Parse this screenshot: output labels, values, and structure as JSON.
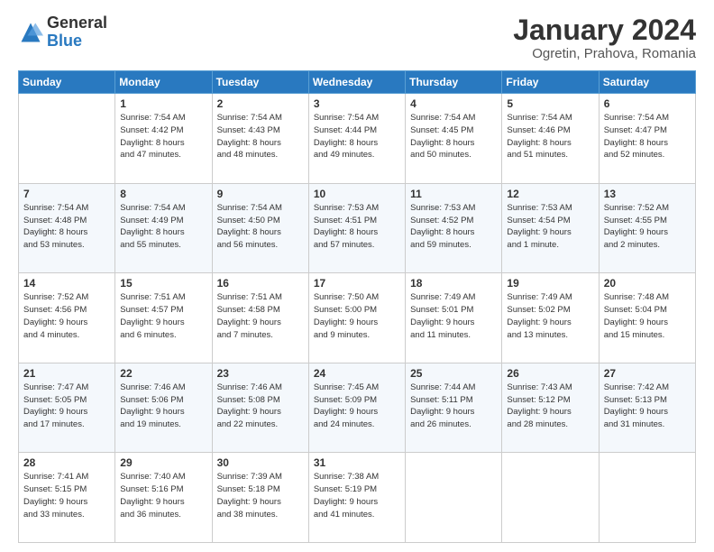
{
  "header": {
    "logo_general": "General",
    "logo_blue": "Blue",
    "title": "January 2024",
    "location": "Ogretin, Prahova, Romania"
  },
  "days_of_week": [
    "Sunday",
    "Monday",
    "Tuesday",
    "Wednesday",
    "Thursday",
    "Friday",
    "Saturday"
  ],
  "weeks": [
    [
      {
        "day": "",
        "info": ""
      },
      {
        "day": "1",
        "info": "Sunrise: 7:54 AM\nSunset: 4:42 PM\nDaylight: 8 hours\nand 47 minutes."
      },
      {
        "day": "2",
        "info": "Sunrise: 7:54 AM\nSunset: 4:43 PM\nDaylight: 8 hours\nand 48 minutes."
      },
      {
        "day": "3",
        "info": "Sunrise: 7:54 AM\nSunset: 4:44 PM\nDaylight: 8 hours\nand 49 minutes."
      },
      {
        "day": "4",
        "info": "Sunrise: 7:54 AM\nSunset: 4:45 PM\nDaylight: 8 hours\nand 50 minutes."
      },
      {
        "day": "5",
        "info": "Sunrise: 7:54 AM\nSunset: 4:46 PM\nDaylight: 8 hours\nand 51 minutes."
      },
      {
        "day": "6",
        "info": "Sunrise: 7:54 AM\nSunset: 4:47 PM\nDaylight: 8 hours\nand 52 minutes."
      }
    ],
    [
      {
        "day": "7",
        "info": "Sunrise: 7:54 AM\nSunset: 4:48 PM\nDaylight: 8 hours\nand 53 minutes."
      },
      {
        "day": "8",
        "info": "Sunrise: 7:54 AM\nSunset: 4:49 PM\nDaylight: 8 hours\nand 55 minutes."
      },
      {
        "day": "9",
        "info": "Sunrise: 7:54 AM\nSunset: 4:50 PM\nDaylight: 8 hours\nand 56 minutes."
      },
      {
        "day": "10",
        "info": "Sunrise: 7:53 AM\nSunset: 4:51 PM\nDaylight: 8 hours\nand 57 minutes."
      },
      {
        "day": "11",
        "info": "Sunrise: 7:53 AM\nSunset: 4:52 PM\nDaylight: 8 hours\nand 59 minutes."
      },
      {
        "day": "12",
        "info": "Sunrise: 7:53 AM\nSunset: 4:54 PM\nDaylight: 9 hours\nand 1 minute."
      },
      {
        "day": "13",
        "info": "Sunrise: 7:52 AM\nSunset: 4:55 PM\nDaylight: 9 hours\nand 2 minutes."
      }
    ],
    [
      {
        "day": "14",
        "info": "Sunrise: 7:52 AM\nSunset: 4:56 PM\nDaylight: 9 hours\nand 4 minutes."
      },
      {
        "day": "15",
        "info": "Sunrise: 7:51 AM\nSunset: 4:57 PM\nDaylight: 9 hours\nand 6 minutes."
      },
      {
        "day": "16",
        "info": "Sunrise: 7:51 AM\nSunset: 4:58 PM\nDaylight: 9 hours\nand 7 minutes."
      },
      {
        "day": "17",
        "info": "Sunrise: 7:50 AM\nSunset: 5:00 PM\nDaylight: 9 hours\nand 9 minutes."
      },
      {
        "day": "18",
        "info": "Sunrise: 7:49 AM\nSunset: 5:01 PM\nDaylight: 9 hours\nand 11 minutes."
      },
      {
        "day": "19",
        "info": "Sunrise: 7:49 AM\nSunset: 5:02 PM\nDaylight: 9 hours\nand 13 minutes."
      },
      {
        "day": "20",
        "info": "Sunrise: 7:48 AM\nSunset: 5:04 PM\nDaylight: 9 hours\nand 15 minutes."
      }
    ],
    [
      {
        "day": "21",
        "info": "Sunrise: 7:47 AM\nSunset: 5:05 PM\nDaylight: 9 hours\nand 17 minutes."
      },
      {
        "day": "22",
        "info": "Sunrise: 7:46 AM\nSunset: 5:06 PM\nDaylight: 9 hours\nand 19 minutes."
      },
      {
        "day": "23",
        "info": "Sunrise: 7:46 AM\nSunset: 5:08 PM\nDaylight: 9 hours\nand 22 minutes."
      },
      {
        "day": "24",
        "info": "Sunrise: 7:45 AM\nSunset: 5:09 PM\nDaylight: 9 hours\nand 24 minutes."
      },
      {
        "day": "25",
        "info": "Sunrise: 7:44 AM\nSunset: 5:11 PM\nDaylight: 9 hours\nand 26 minutes."
      },
      {
        "day": "26",
        "info": "Sunrise: 7:43 AM\nSunset: 5:12 PM\nDaylight: 9 hours\nand 28 minutes."
      },
      {
        "day": "27",
        "info": "Sunrise: 7:42 AM\nSunset: 5:13 PM\nDaylight: 9 hours\nand 31 minutes."
      }
    ],
    [
      {
        "day": "28",
        "info": "Sunrise: 7:41 AM\nSunset: 5:15 PM\nDaylight: 9 hours\nand 33 minutes."
      },
      {
        "day": "29",
        "info": "Sunrise: 7:40 AM\nSunset: 5:16 PM\nDaylight: 9 hours\nand 36 minutes."
      },
      {
        "day": "30",
        "info": "Sunrise: 7:39 AM\nSunset: 5:18 PM\nDaylight: 9 hours\nand 38 minutes."
      },
      {
        "day": "31",
        "info": "Sunrise: 7:38 AM\nSunset: 5:19 PM\nDaylight: 9 hours\nand 41 minutes."
      },
      {
        "day": "",
        "info": ""
      },
      {
        "day": "",
        "info": ""
      },
      {
        "day": "",
        "info": ""
      }
    ]
  ]
}
